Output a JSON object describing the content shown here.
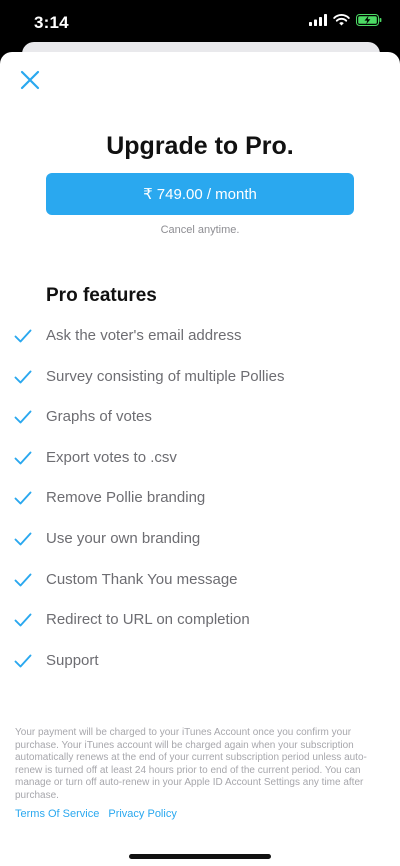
{
  "status_bar": {
    "time": "3:14"
  },
  "sheet": {
    "title": "Upgrade to Pro.",
    "price_button": "₹ 749.00 / month",
    "cancel_note": "Cancel anytime.",
    "features_heading": "Pro features",
    "features": [
      "Ask the voter's email address",
      "Survey consisting of multiple Pollies",
      "Graphs of votes",
      "Export votes to .csv",
      "Remove Pollie branding",
      "Use your own branding",
      "Custom Thank You message",
      "Redirect to URL on completion",
      "Support"
    ],
    "legal_text": "Your payment will be charged to your iTunes Account once you confirm your purchase. Your iTunes account will be charged again when your subscription automatically renews at the end of your current subscription period unless auto-renew is turned off at least 24 hours prior to end of the current period. You can manage or turn off auto-renew in your Apple ID Account Settings any time after purchase.",
    "links": {
      "terms": "Terms Of Service",
      "privacy": "Privacy Policy"
    }
  },
  "colors": {
    "accent": "#2aa8ef",
    "battery": "#4cd964"
  }
}
